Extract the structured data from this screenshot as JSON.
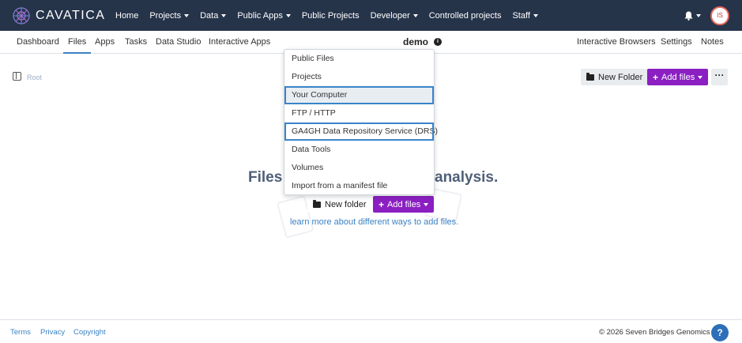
{
  "brand": {
    "name": "CAVATICA"
  },
  "topnav": {
    "items": [
      {
        "label": "Home",
        "dropdown": false
      },
      {
        "label": "Projects",
        "dropdown": true
      },
      {
        "label": "Data",
        "dropdown": true
      },
      {
        "label": "Public Apps",
        "dropdown": true
      },
      {
        "label": "Public Projects",
        "dropdown": false
      },
      {
        "label": "Developer",
        "dropdown": true
      },
      {
        "label": "Controlled projects",
        "dropdown": false
      },
      {
        "label": "Staff",
        "dropdown": true
      }
    ],
    "avatar_initials": "IS"
  },
  "subnav": {
    "tabs": [
      "Dashboard",
      "Files",
      "Apps",
      "Tasks",
      "Data Studio",
      "Interactive Apps"
    ],
    "active_tab": "Files",
    "project_title": "demo",
    "right_tabs": [
      "Interactive Browsers",
      "Settings",
      "Notes"
    ]
  },
  "toolbar": {
    "root_label": "Root",
    "new_folder_label": "New Folder",
    "add_files_label": "Add files"
  },
  "empty_state": {
    "heading_left": "Files",
    "heading_right": "analysis.",
    "new_folder_label": "New folder",
    "add_files_label": "Add files",
    "learn_more": "learn more about different ways to add files."
  },
  "dropdown": {
    "items": [
      "Public Files",
      "Projects",
      "Your Computer",
      "FTP / HTTP",
      "GA4GH Data Repository Service (DRS)",
      "Data Tools",
      "Volumes",
      "Import from a manifest file"
    ],
    "highlighted": "Your Computer",
    "focused": "GA4GH Data Repository Service (DRS)"
  },
  "footer": {
    "links": [
      "Terms",
      "Privacy",
      "Copyright"
    ],
    "copyright": "© 2026 Seven Bridges Genomics",
    "help_label": "?"
  },
  "colors": {
    "topnav_bg": "#26344a",
    "accent_purple": "#8b1fc2",
    "link_blue": "#3b82c4",
    "focus_outline": "#3a84c9"
  }
}
